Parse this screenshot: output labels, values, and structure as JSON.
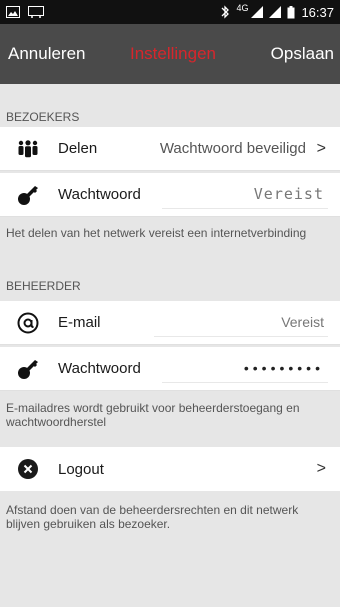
{
  "status_bar": {
    "bluetooth": "bluetooth-icon",
    "network": "4G",
    "time": "16:37"
  },
  "app_bar": {
    "cancel_label": "Annuleren",
    "title": "Instellingen",
    "save_label": "Opslaan",
    "title_color": "#d7262c"
  },
  "visitors": {
    "header": "BEZOEKERS",
    "share": {
      "icon": "people-icon",
      "label": "Delen",
      "value": "Wachtwoord beveiligd"
    },
    "password": {
      "icon": "key-icon",
      "label": "Wachtwoord",
      "placeholder": "Vereist"
    },
    "note": "Het delen van het netwerk vereist een internetverbinding"
  },
  "admin": {
    "header": "BEHEERDER",
    "email": {
      "icon": "at-icon",
      "label": "E-mail",
      "placeholder": "Vereist"
    },
    "password": {
      "icon": "key-icon",
      "label": "Wachtwoord",
      "value": "•••••••••"
    },
    "note": "E-mailadres wordt gebruikt voor beheerderstoegang en wachtwoordherstel"
  },
  "logout": {
    "icon": "close-circle-icon",
    "label": "Logout",
    "note": "Afstand doen van de beheerdersrechten en dit netwerk blijven gebruiken als bezoeker."
  }
}
